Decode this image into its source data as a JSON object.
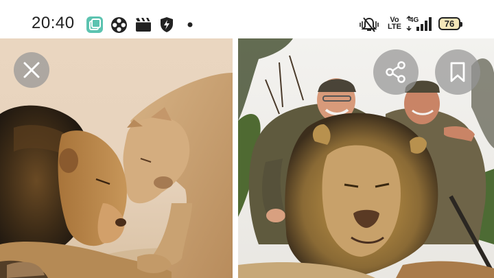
{
  "status_bar": {
    "time": "20:40",
    "notification_icons": [
      "app-switch-icon",
      "film-reel-icon",
      "clapperboard-icon",
      "shield-bolt-icon",
      "more-dot-icon"
    ],
    "system_icons": [
      "vibrate-mute-icon",
      "volte-icon",
      "4g-signal-icon",
      "battery-icon"
    ],
    "volte_top": "Vo",
    "volte_bottom": "LTE",
    "network": "4G",
    "battery_level": "76"
  },
  "viewer": {
    "left_image_desc": "lion-and-lioness",
    "right_image_desc": "hunters-with-lion",
    "close_icon": "close-icon",
    "share_icon": "share-icon",
    "bookmark_icon": "bookmark-icon"
  },
  "colors": {
    "status_text": "#222222",
    "overlay_button": "#969696",
    "battery_fill": "#f4e6b8",
    "app_icon_teal": "#5cc3b0"
  }
}
